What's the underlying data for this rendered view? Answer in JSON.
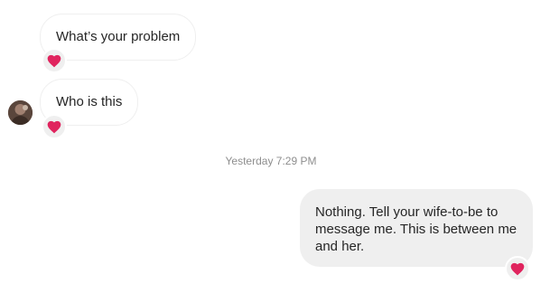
{
  "conversation": {
    "messages": [
      {
        "direction": "incoming",
        "text": "What’s your problem",
        "reaction": "red-heart"
      },
      {
        "direction": "incoming",
        "text": "Who is this",
        "reaction": "red-heart"
      },
      {
        "direction": "outgoing",
        "text": "Nothing. Tell your wife-to-be to message me. This is between me and her.",
        "reaction": "red-heart"
      }
    ],
    "timestamp": "Yesterday 7:29 PM"
  },
  "colors": {
    "reaction_heart": "#e0245e",
    "outgoing_bubble": "#efefef",
    "timestamp_text": "#8e8e8e"
  }
}
